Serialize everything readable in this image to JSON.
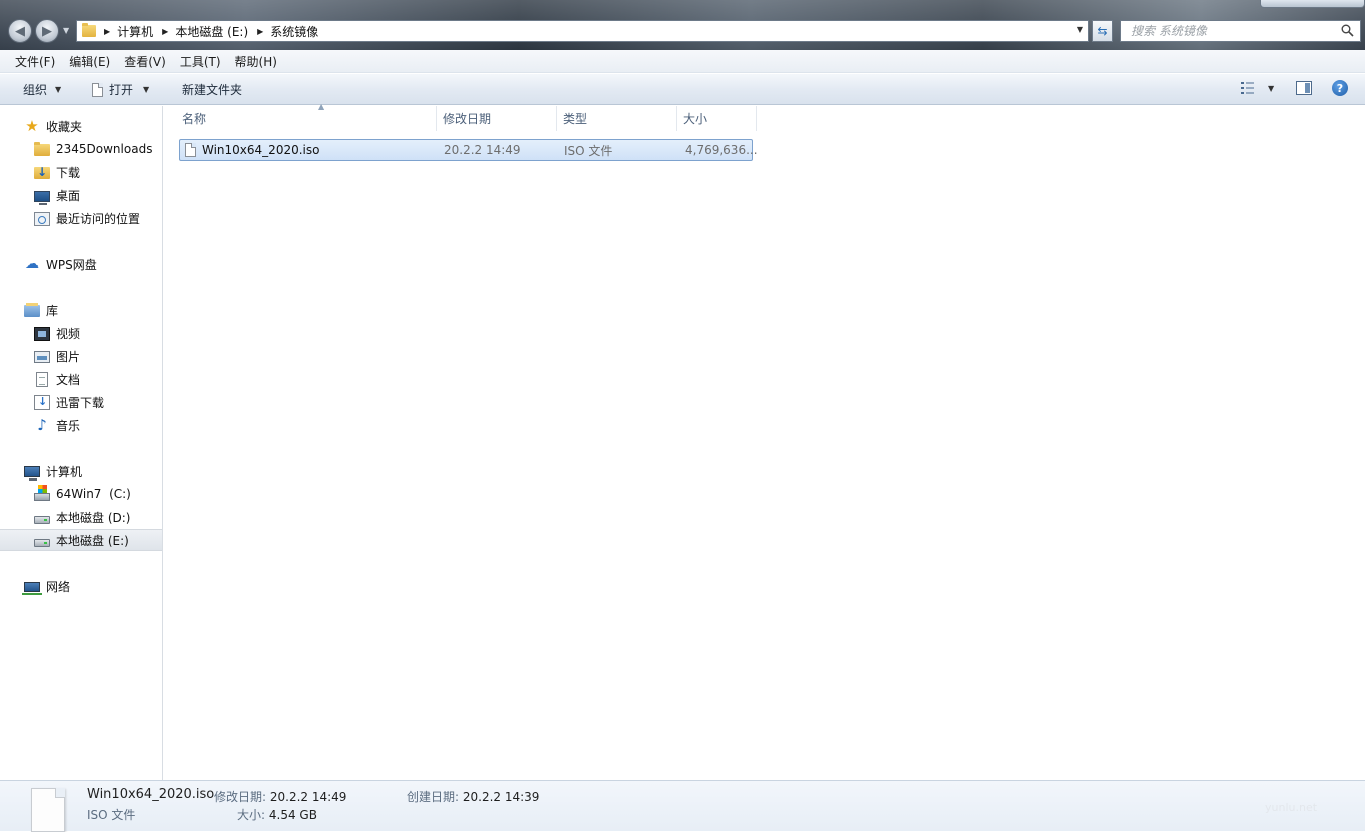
{
  "address": {
    "crumbs": [
      "计算机",
      "本地磁盘 (E:)",
      "系统镜像"
    ]
  },
  "search": {
    "placeholder": "搜索 系统镜像"
  },
  "menu": [
    "文件(F)",
    "编辑(E)",
    "查看(V)",
    "工具(T)",
    "帮助(H)"
  ],
  "toolbar": {
    "organize": "组织",
    "open": "打开",
    "new_folder": "新建文件夹"
  },
  "nav": {
    "favorites": {
      "label": "收藏夹",
      "items": [
        "2345Downloads",
        "下载",
        "桌面",
        "最近访问的位置"
      ]
    },
    "wps": "WPS网盘",
    "libraries": {
      "label": "库",
      "items": [
        "视频",
        "图片",
        "文档",
        "迅雷下载",
        "音乐"
      ]
    },
    "computer": {
      "label": "计算机",
      "items": [
        "64Win7  (C:)",
        "本地磁盘 (D:)",
        "本地磁盘 (E:)"
      ],
      "selected_index": 2
    },
    "network": "网络"
  },
  "columns": [
    "名称",
    "修改日期",
    "类型",
    "大小"
  ],
  "files": [
    {
      "name": "Win10x64_2020.iso",
      "date": "20.2.2 14:49",
      "type": "ISO 文件",
      "size": "4,769,636..."
    }
  ],
  "details": {
    "name": "Win10x64_2020.iso",
    "type": "ISO 文件",
    "modified_label": "修改日期:",
    "modified": "20.2.2 14:49",
    "size_label": "大小:",
    "size": "4.54 GB",
    "created_label": "创建日期:",
    "created": "20.2.2 14:39"
  },
  "watermark": "yunlu.net",
  "colors": {
    "selection": "#cfe1f7",
    "selection_border": "#7da2ce",
    "header_text": "#4c607a"
  }
}
